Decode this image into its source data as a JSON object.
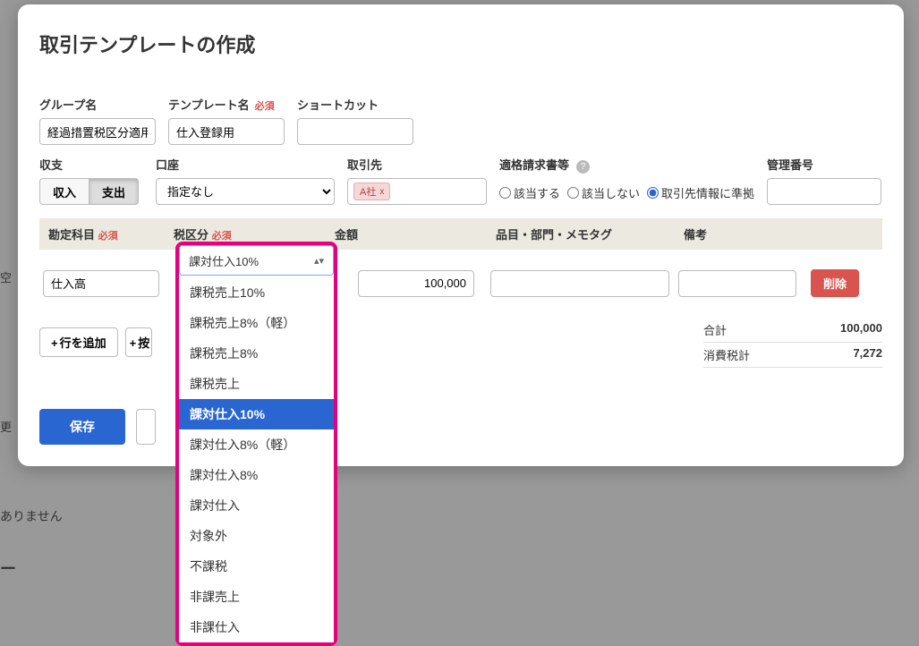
{
  "backdrop": {
    "line1": "空",
    "line2": "更",
    "line3": "ありません",
    "line4": "ー"
  },
  "dialog": {
    "title": "取引テンプレートの作成",
    "labels": {
      "group_name": "グループ名",
      "template_name": "テンプレート名",
      "shortcut": "ショートカット",
      "income_expense": "収支",
      "account": "口座",
      "partner": "取引先",
      "qualified_invoice": "適格請求書等",
      "management_no": "管理番号",
      "required": "必須"
    },
    "values": {
      "group_name": "経過措置税区分適用",
      "template_name": "仕入登録用",
      "shortcut": "",
      "income_label": "収入",
      "expense_label": "支出",
      "account_selected": "指定なし",
      "partner_tag": "A社",
      "invoice_opt1": "該当する",
      "invoice_opt2": "該当しない",
      "invoice_opt3": "取引先情報に準拠",
      "management_no": ""
    },
    "grid": {
      "headers": {
        "subject": "勘定科目",
        "tax": "税区分",
        "amount": "金額",
        "item": "品目・部門・メモタグ",
        "note": "備考"
      },
      "row": {
        "subject": "仕入高",
        "amount": "100,000",
        "item": "",
        "note": "",
        "delete": "削除"
      },
      "add_row": "行を追加",
      "add_control": "按"
    },
    "totals": {
      "total_label": "合計",
      "total_value": "100,000",
      "tax_label": "消費税計",
      "tax_value": "7,272"
    },
    "save": "保存"
  },
  "tax_dropdown": {
    "selected": "課対仕入10%",
    "options": [
      "課税売上10%",
      "課税売上8%（軽）",
      "課税売上8%",
      "課税売上",
      "課対仕入10%",
      "課対仕入8%（軽）",
      "課対仕入8%",
      "課対仕入",
      "対象外",
      "不課税",
      "非課売上",
      "非課仕入"
    ],
    "selected_index": 4
  },
  "chart_data": null
}
